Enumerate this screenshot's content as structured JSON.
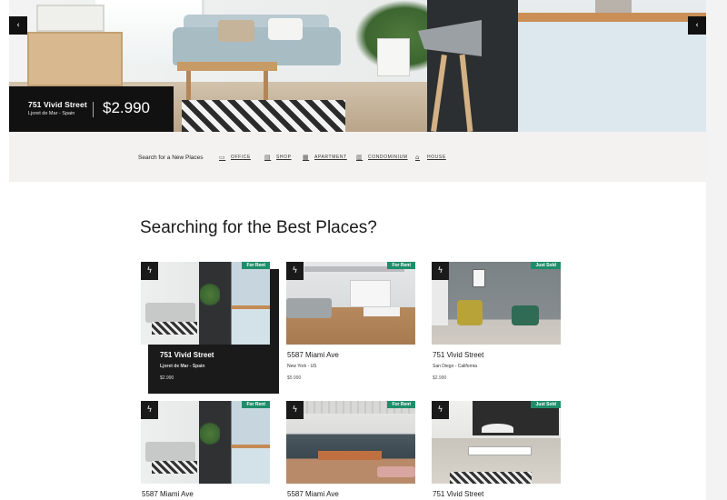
{
  "hero": {
    "address": "751 Vivid Street",
    "location": "Ljoret de Mar - Spain",
    "price": "$2.990",
    "prev_icon": "chevron-left-icon",
    "next_icon": "chevron-left-icon"
  },
  "search": {
    "label": "Search for a New Places",
    "categories": [
      {
        "label": "OFFICE",
        "icon": "office-icon"
      },
      {
        "label": "SHOP",
        "icon": "shop-icon"
      },
      {
        "label": "APARTMENT",
        "icon": "apartment-icon"
      },
      {
        "label": "CONDOMINIUM",
        "icon": "condominium-icon"
      },
      {
        "label": "HOUSE",
        "icon": "house-icon"
      }
    ]
  },
  "section": {
    "title": "Searching for the Best Places?"
  },
  "listings": [
    {
      "address": "751 Vivid Street",
      "location": "Ljoret de Mar - Spain",
      "price": "$2.990",
      "badge": "For Rent"
    },
    {
      "address": "5587 Miami Ave",
      "location": "New York - US",
      "price": "$5.990",
      "badge": "For Rent"
    },
    {
      "address": "751 Vivid Street",
      "location": "San Diego - California",
      "price": "$2.990",
      "badge": "Just Sold"
    },
    {
      "address": "5587 Miami Ave",
      "location": "",
      "price": "",
      "badge": "For Rent"
    },
    {
      "address": "5587 Miami Ave",
      "location": "",
      "price": "",
      "badge": "For Rent"
    },
    {
      "address": "751 Vivid Street",
      "location": "",
      "price": "",
      "badge": "Just Sold"
    }
  ],
  "colors": {
    "badge": "#1e8e6a",
    "dark": "#1a1a1a",
    "search_band": "#f4f1f1"
  }
}
